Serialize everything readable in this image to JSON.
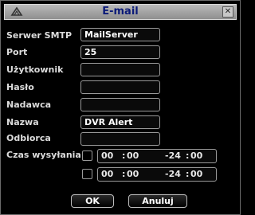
{
  "window": {
    "title": "E-mail"
  },
  "fields": [
    {
      "label": "Serwer SMTP",
      "value": "MailServer"
    },
    {
      "label": "Port",
      "value": "25"
    },
    {
      "label": "Użytkownik",
      "value": ""
    },
    {
      "label": "Hasło",
      "value": ""
    },
    {
      "label": "Nadawca",
      "value": ""
    },
    {
      "label": "Nazwa",
      "value": "DVR Alert"
    },
    {
      "label": "Odbiorca",
      "value": ""
    }
  ],
  "schedule": {
    "label": "Czas wysyłania",
    "rows": [
      {
        "start_h": "00",
        "start_m": "00",
        "end_h": "-24",
        "end_m": "00"
      },
      {
        "start_h": "00",
        "start_m": "00",
        "end_h": "-24",
        "end_m": "00"
      }
    ]
  },
  "buttons": {
    "ok": "OK",
    "cancel": "Anuluj"
  }
}
